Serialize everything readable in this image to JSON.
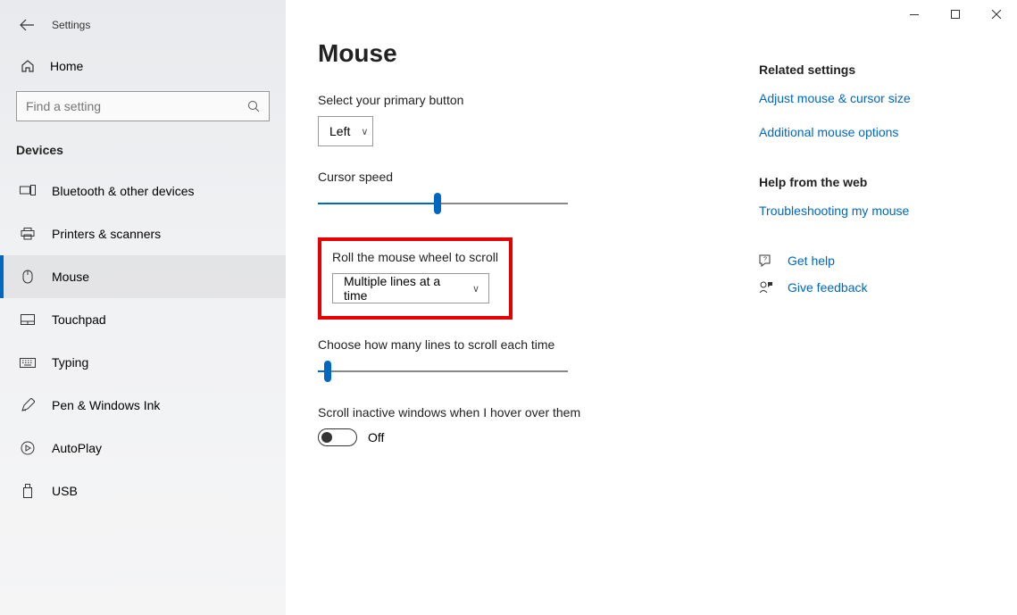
{
  "app_title": "Settings",
  "home_label": "Home",
  "search_placeholder": "Find a setting",
  "section_title": "Devices",
  "nav": [
    {
      "label": "Bluetooth & other devices"
    },
    {
      "label": "Printers & scanners"
    },
    {
      "label": "Mouse"
    },
    {
      "label": "Touchpad"
    },
    {
      "label": "Typing"
    },
    {
      "label": "Pen & Windows Ink"
    },
    {
      "label": "AutoPlay"
    },
    {
      "label": "USB"
    }
  ],
  "page_title": "Mouse",
  "primary_button": {
    "label": "Select your primary button",
    "value": "Left"
  },
  "cursor_speed": {
    "label": "Cursor speed",
    "value": 48
  },
  "wheel_scroll": {
    "label": "Roll the mouse wheel to scroll",
    "value": "Multiple lines at a time"
  },
  "lines_each": {
    "label": "Choose how many lines to scroll each time",
    "value": 4
  },
  "inactive": {
    "label": "Scroll inactive windows when I hover over them",
    "state_label": "Off",
    "on": false
  },
  "rail": {
    "related_heading": "Related settings",
    "related_links": [
      "Adjust mouse & cursor size",
      "Additional mouse options"
    ],
    "help_heading": "Help from the web",
    "help_links": [
      "Troubleshooting my mouse"
    ],
    "get_help": "Get help",
    "feedback": "Give feedback"
  }
}
